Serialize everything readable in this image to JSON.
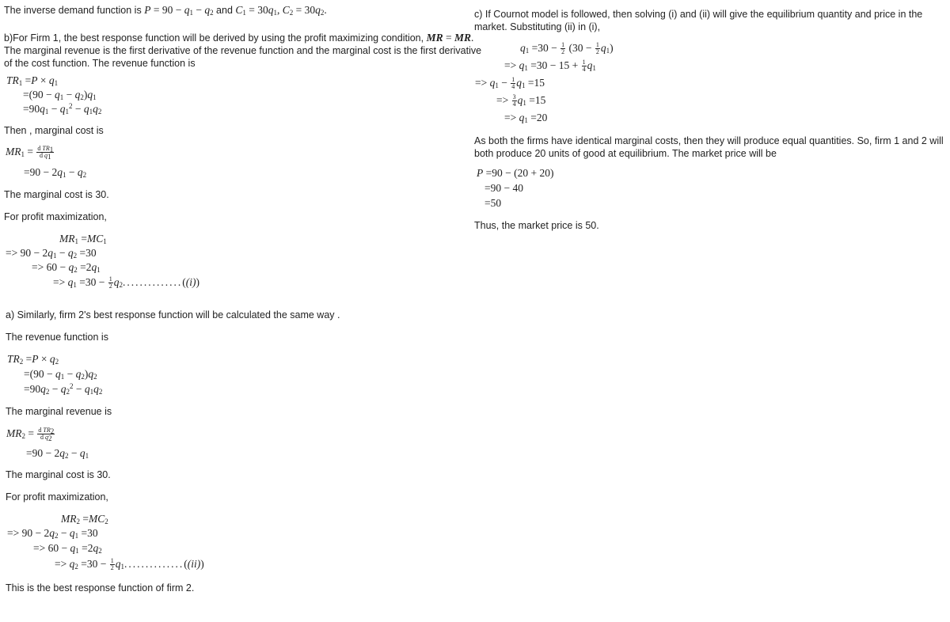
{
  "intro": {
    "text": "The inverse demand function is",
    "demand": "P = 90 − q₁ − q₂",
    "and": "and",
    "costs": "C₁ = 30q₁, C₂ = 30q₂."
  },
  "part_b": {
    "para_line1": "b)For Firm 1, the best response function will be derived by using the profit maximizing condition, MR = MR.",
    "para_line2": "The marginal revenue is the first derivative of the revenue function and the marginal cost is the first derivative",
    "para_line3": "of the cost function. The revenue function is",
    "tr1": [
      "TR₁ = P × q₁",
      "= (90 − q₁ − q₂)q₁",
      "= 90q₁ − q₁² − q₁q₂"
    ],
    "then_mc": "Then , marginal cost is",
    "mr1": [
      "MR₁ = dTR₁/dq₁",
      "= 90 − 2q₁ − q₂"
    ],
    "mc_text": "The marginal cost is 30.",
    "profit_max": "For profit maximization,",
    "steps": [
      "MR₁ = MC₁",
      "=> 90 − 2q₁ − q₂ = 30",
      "=> 60 − q₂ = 2q₁",
      "=> q₁ = 30 − ½q₂ .............. (i)"
    ]
  },
  "part_a": {
    "intro": "a) Similarly, firm 2's best response function will be calculated the same way .",
    "rev_text": "The revenue function is",
    "tr2": [
      "TR₂ = P × q₂",
      "= (90 − q₁ − q₂)q₂",
      "= 90q₂ − q₂² − q₁q₂"
    ],
    "mr_text": "The marginal revenue is",
    "mr2": [
      "MR₂ = dTR₂/dq₂",
      "= 90 − 2q₂ − q₁"
    ],
    "mc_text": "The marginal cost is 30.",
    "profit_max": "For profit maximization,",
    "steps": [
      "MR₂ = MC₂",
      "=> 90 − 2q₂ − q₁ = 30",
      "=> 60 − q₁ = 2q₂",
      "=> q₂ = 30 − ½q₁ .............. (ii)"
    ],
    "conclusion": "This is the best response function of firm 2."
  },
  "part_c": {
    "para_line1": "c) If Cournot model is followed, then solving (i) and (ii) will give the equilibrium quantity and price in the",
    "para_line2": "market. Substituting (ii) in (i),",
    "steps": [
      "q₁ = 30 − ½ (30 − ½q₁)",
      "=> q₁ = 30 − 15 + ¼q₁",
      "=> q₁ − ¼q₁ = 15",
      "=> ¾q₁ = 15",
      "=> q₁ = 20"
    ],
    "eq_line1": "As both the firms have identical marginal costs, then they will produce equal quantities. So, firm 1 and 2 will",
    "eq_line2": "both produce 20 units of good at equilibrium. The market price will be",
    "price": [
      "P = 90 − (20 + 20)",
      "= 90 − 40",
      "= 50"
    ],
    "conclusion": "Thus, the market price is 50."
  },
  "labels": {
    "eq_i": "(i)",
    "eq_ii": "(ii)",
    "dots": ".............."
  }
}
